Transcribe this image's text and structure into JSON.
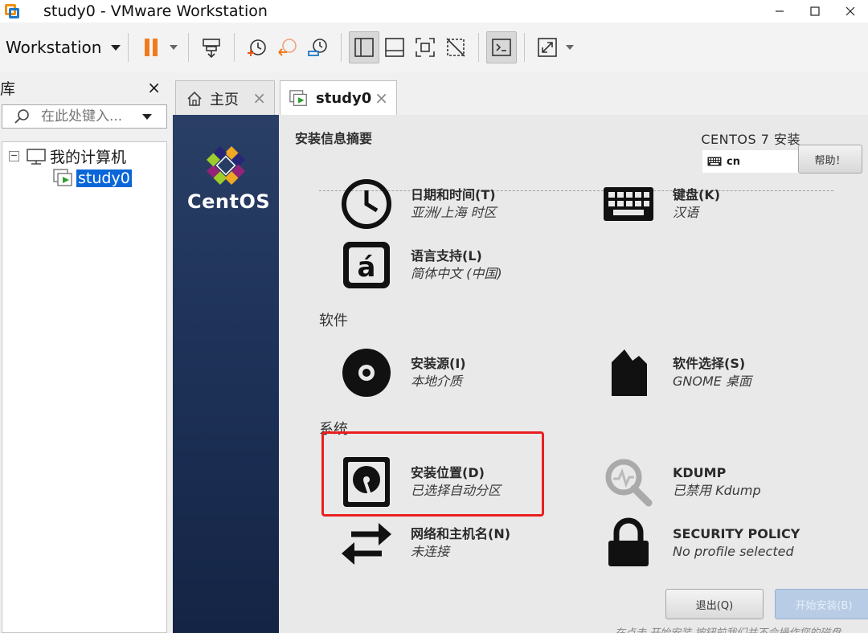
{
  "window": {
    "title": "study0 - VMware Workstation"
  },
  "toolbar": {
    "menu_label": "Workstation"
  },
  "library": {
    "title": "库",
    "close": "×",
    "search_placeholder": "在此处键入...",
    "tree": {
      "root_label": "我的计算机",
      "root_expander": "−",
      "vm_label": "study0"
    }
  },
  "tabs": [
    {
      "label": "主页",
      "close": "×"
    },
    {
      "label": "study0",
      "close": "×"
    }
  ],
  "installer": {
    "brand": "CentOS",
    "summary_title": "安装信息摘要",
    "install_title": "CENTOS 7 安装",
    "keyboard_layout": "cn",
    "help_label": "帮助！",
    "sections": {
      "software": "软件",
      "system": "系统"
    },
    "spokes": {
      "datetime": {
        "title": "日期和时间(T)",
        "status": "亚洲/上海 时区"
      },
      "keyboard": {
        "title": "键盘(K)",
        "status": "汉语"
      },
      "language": {
        "title": "语言支持(L)",
        "status": "简体中文 (中国)"
      },
      "source": {
        "title": "安装源(I)",
        "status": "本地介质"
      },
      "software_selection": {
        "title": "软件选择(S)",
        "status": "GNOME 桌面"
      },
      "destination": {
        "title": "安装位置(D)",
        "status": "已选择自动分区"
      },
      "kdump": {
        "title": "KDUMP",
        "status": "已禁用 Kdump"
      },
      "network": {
        "title": "网络和主机名(N)",
        "status": "未连接"
      },
      "security": {
        "title": "SECURITY POLICY",
        "status": "No profile selected"
      }
    },
    "quit_label": "退出(Q)",
    "begin_label": "开始安装(B)",
    "footnote": "在点击 开始安装 按钮前我们并不会操作您的磁盘。"
  },
  "colors": {
    "highlight": "#e8201f",
    "selection": "#0a66d8",
    "vm_sidebar": "#1e3259"
  }
}
